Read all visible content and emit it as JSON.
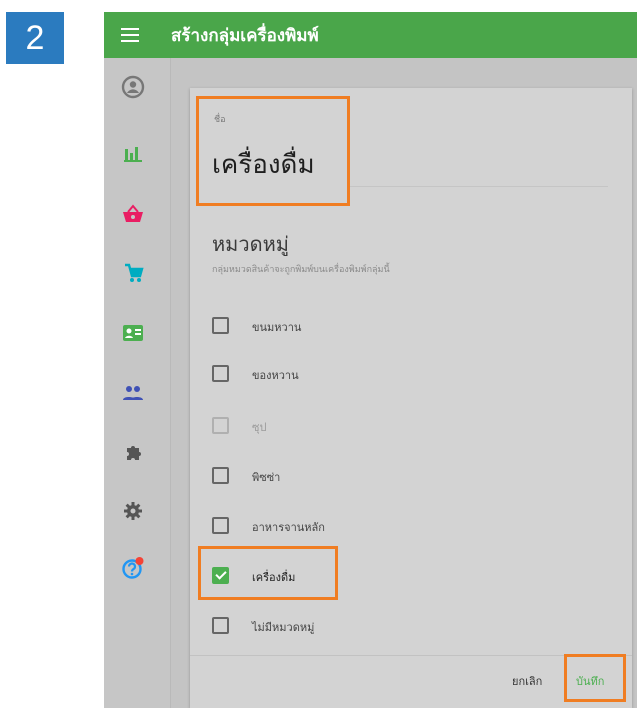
{
  "step_number": "2",
  "appbar": {
    "title": "สร้างกลุ่มเครื่องพิมพ์"
  },
  "sidebar": {
    "items": [
      {
        "icon": "account-circle-icon",
        "color": "#777777"
      },
      {
        "icon": "bar-chart-icon",
        "color": "#4caf50"
      },
      {
        "icon": "shopping-basket-icon",
        "color": "#e91e63"
      },
      {
        "icon": "cart-icon",
        "color": "#00acc1"
      },
      {
        "icon": "contact-card-icon",
        "color": "#4caf50"
      },
      {
        "icon": "people-icon",
        "color": "#3f51b5"
      },
      {
        "icon": "puzzle-icon",
        "color": "#555555"
      },
      {
        "icon": "gear-icon",
        "color": "#555555"
      },
      {
        "icon": "help-icon",
        "color": "#2196f3",
        "badge_color": "#f44336"
      }
    ]
  },
  "form": {
    "name_label": "ชื่อ",
    "name_value": "เครื่องดื่ม",
    "category_title": "หมวดหมู่",
    "category_hint": "กลุ่มหมวดสินค้าจะถูกพิมพ์บนเครื่องพิมพ์กลุ่มนี้",
    "categories": [
      {
        "label": "ขนมหวาน",
        "checked": false,
        "disabled": false
      },
      {
        "label": "ของหวาน",
        "checked": false,
        "disabled": false
      },
      {
        "label": "ซุป",
        "checked": false,
        "disabled": true
      },
      {
        "label": "พิซซ่า",
        "checked": false,
        "disabled": false
      },
      {
        "label": "อาหารจานหลัก",
        "checked": false,
        "disabled": false
      },
      {
        "label": "เครื่องดื่ม",
        "checked": true,
        "disabled": false
      },
      {
        "label": "ไม่มีหมวดหมู่",
        "checked": false,
        "disabled": false
      }
    ]
  },
  "actions": {
    "cancel": "ยกเลิก",
    "save": "บันทึก"
  },
  "colors": {
    "appbar": "#4aa64a",
    "highlight": "#f07d22",
    "step_badge": "#2b7bbf",
    "accent": "#4caf50"
  }
}
